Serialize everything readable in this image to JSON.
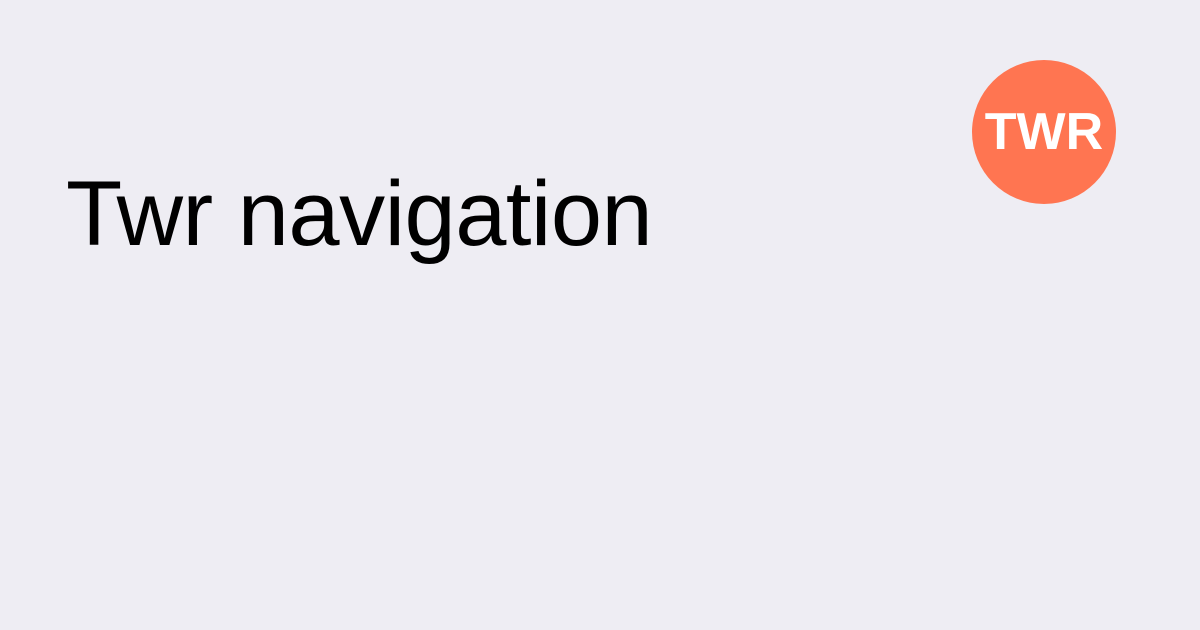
{
  "page": {
    "title": "Twr navigation",
    "background_color": "#EEEDF3"
  },
  "logo": {
    "text": "TWR",
    "background_color": "#FF7551",
    "text_color": "#FFFFFF"
  }
}
